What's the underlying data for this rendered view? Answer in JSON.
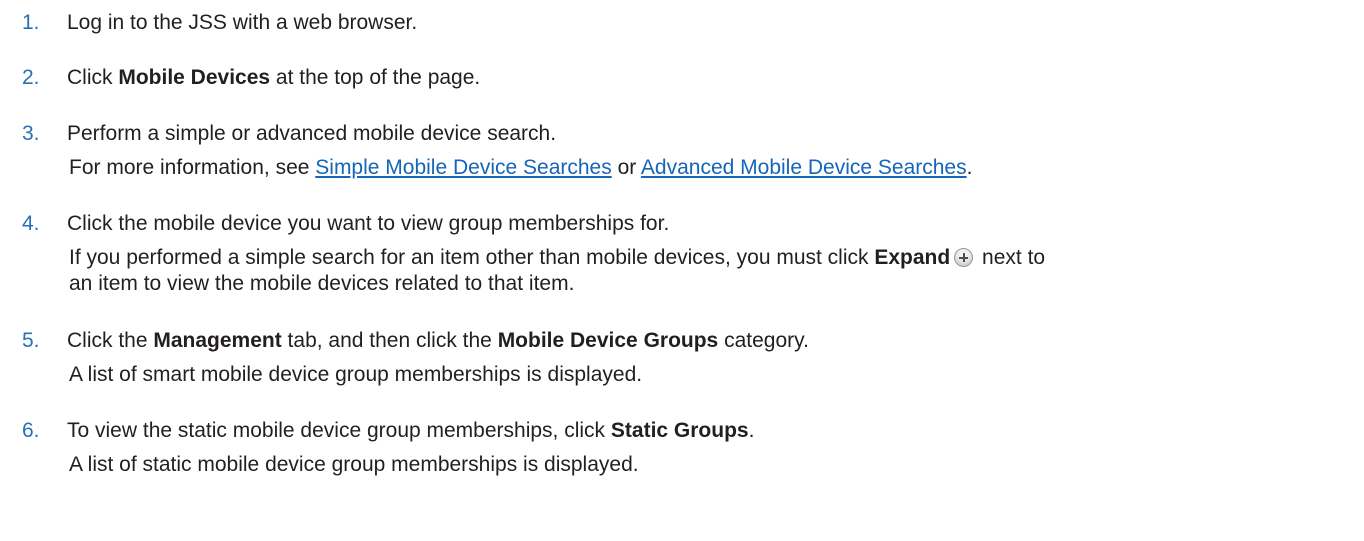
{
  "steps": [
    {
      "number": "1.",
      "lines": [
        {
          "t1": "Log in to the JSS with a web browser."
        }
      ]
    },
    {
      "number": "2.",
      "lines": [
        {
          "t1": "Click ",
          "b1": "Mobile Devices",
          "t2": " at the top of the page."
        }
      ]
    },
    {
      "number": "3.",
      "lines": [
        {
          "t1": "Perform a simple or advanced mobile device search."
        },
        {
          "t1": "For more information, see ",
          "link1": "Simple Mobile Device Searches",
          "t2": " or ",
          "link2": "Advanced Mobile Device Searches",
          "t3": "."
        }
      ]
    },
    {
      "number": "4.",
      "lines": [
        {
          "t1": "Click the mobile device you want to view group memberships for."
        },
        {
          "t1": "If you performed a simple search for an item other than mobile devices, you must click ",
          "b1": "Expand",
          "t2": " next to"
        },
        {
          "t1": "an item to view the mobile devices related to that item."
        }
      ]
    },
    {
      "number": "5.",
      "lines": [
        {
          "t1": "Click the ",
          "b1": "Management",
          "t2": " tab, and then click the ",
          "b2": "Mobile Device Groups",
          "t3": " category."
        },
        {
          "t1": "A list of smart mobile device group memberships is displayed."
        }
      ]
    },
    {
      "number": "6.",
      "lines": [
        {
          "t1": "To view the static mobile device group memberships, click ",
          "b1": "Static Groups",
          "t2": "."
        },
        {
          "t1": "A list of static mobile device group memberships is displayed."
        }
      ]
    }
  ],
  "icons": {
    "expand": "plus-circle-icon"
  },
  "colors": {
    "number": "#2b6fb6",
    "link": "#1565b8",
    "text": "#231f20"
  }
}
